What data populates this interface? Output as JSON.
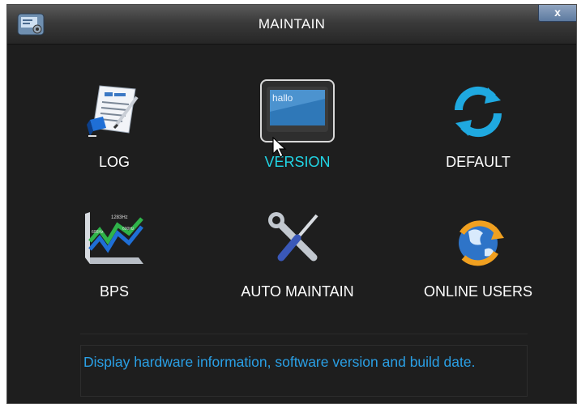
{
  "window": {
    "title": "MAINTAIN",
    "close_label": "x"
  },
  "tiles": [
    {
      "label": "LOG",
      "icon": "log-document-icon",
      "active": false
    },
    {
      "label": "VERSION",
      "icon": "version-screen-icon",
      "screen_text": "hallo",
      "active": true
    },
    {
      "label": "DEFAULT",
      "icon": "refresh-arrows-icon",
      "active": false
    },
    {
      "label": "BPS",
      "icon": "bps-chart-icon",
      "chart_text": [
        "1283Hz",
        "600Hz",
        "600Hz"
      ],
      "active": false
    },
    {
      "label": "AUTO MAINTAIN",
      "icon": "wrench-screwdriver-icon",
      "active": false
    },
    {
      "label": "ONLINE USERS",
      "icon": "globe-users-icon",
      "active": false
    }
  ],
  "description": "Display hardware information, software version and build date.",
  "colors": {
    "background": "#1e1e1e",
    "label": "#ffffff",
    "active_label": "#21d6e6",
    "description": "#2aa0e6"
  }
}
